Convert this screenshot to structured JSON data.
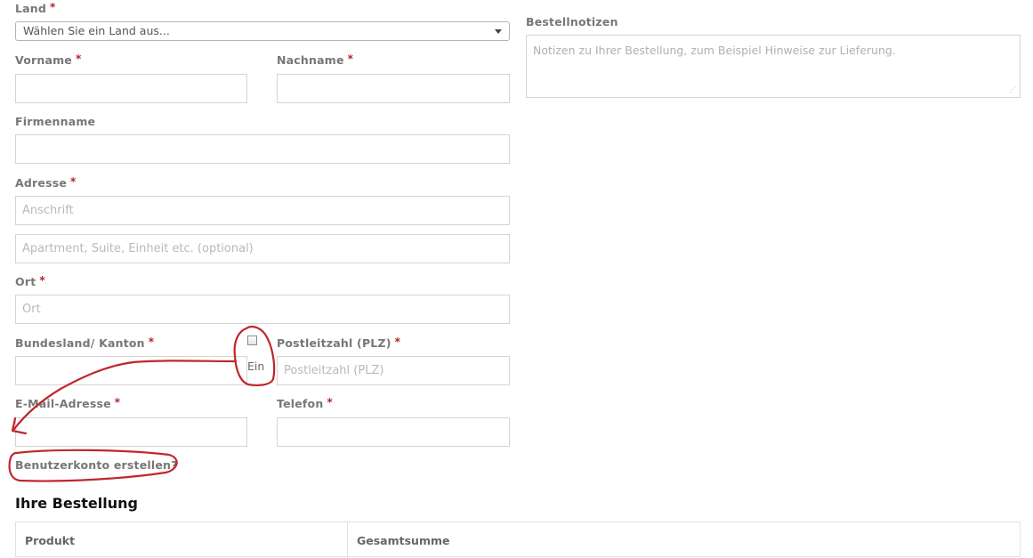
{
  "billing": {
    "country": {
      "label": "Land",
      "selected": "Wählen Sie ein Land aus..."
    },
    "first_name": {
      "label": "Vorname",
      "value": ""
    },
    "last_name": {
      "label": "Nachname",
      "value": ""
    },
    "company": {
      "label": "Firmenname",
      "value": ""
    },
    "address": {
      "label": "Adresse",
      "line1_placeholder": "Anschrift",
      "line2_placeholder": "Apartment, Suite, Einheit etc. (optional)"
    },
    "city": {
      "label": "Ort",
      "placeholder": "Ort"
    },
    "state": {
      "label": "Bundesland/ Kanton",
      "value": ""
    },
    "postcode": {
      "label": "Postleitzahl (PLZ)",
      "placeholder": "Postleitzahl (PLZ)"
    },
    "email": {
      "label": "E-Mail-Adresse",
      "value": ""
    },
    "phone": {
      "label": "Telefon",
      "value": ""
    },
    "required_marker": "*"
  },
  "stray_checkbox": {
    "checked": false,
    "text": "Ein"
  },
  "create_account": {
    "label": "Benutzerkonto erstellen?"
  },
  "order_notes": {
    "label": "Bestellnotizen",
    "placeholder": "Notizen zu Ihrer Bestellung, zum Beispiel Hinweise zur Lieferung."
  },
  "order": {
    "heading": "Ihre Bestellung",
    "columns": [
      "Produkt",
      "Gesamtsumme"
    ]
  },
  "colors": {
    "required": "#b8202b",
    "annotation": "#c0262d"
  }
}
